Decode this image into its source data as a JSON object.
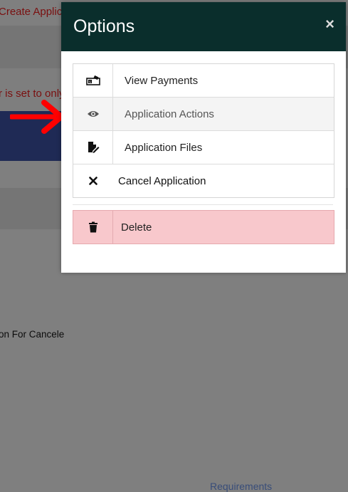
{
  "background": {
    "create_link": "Create Applic",
    "warning_text": "r is set to only",
    "card_text": "on For Cancele",
    "requirements_link": "Requirements"
  },
  "modal": {
    "title": "Options",
    "close_symbol": "×",
    "items": [
      {
        "label": "View Payments",
        "icon": "payments-icon"
      },
      {
        "label": "Application Actions",
        "icon": "eye-icon"
      },
      {
        "label": "Application Files",
        "icon": "file-edit-icon"
      },
      {
        "label": "Cancel Application",
        "icon": "close-icon"
      }
    ],
    "delete": {
      "label": "Delete",
      "icon": "trash-icon"
    }
  },
  "colors": {
    "header": "#0a2e2c",
    "delete_bg": "#f8c8cc",
    "arrow": "#ff0000"
  }
}
